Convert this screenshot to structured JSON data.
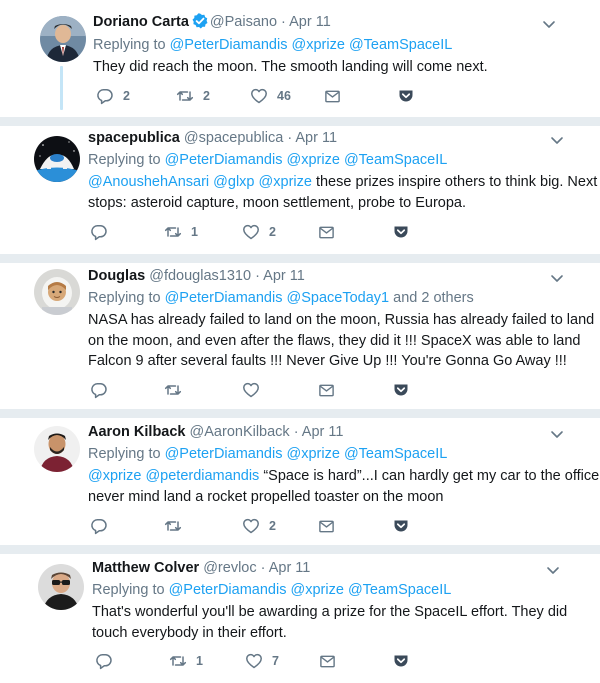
{
  "accent": "#1da1f2",
  "tweets": [
    {
      "name": "Doriano Carta",
      "verified": true,
      "handle": "@Paisano",
      "separator": "·",
      "date": "Apr 11",
      "replying_label": "Replying to",
      "replying_to": [
        "@PeterDiamandis",
        "@xprize",
        "@TeamSpaceIL"
      ],
      "body_text": "They did reach the moon. The smooth landing will come next.",
      "replies": "2",
      "retweets": "2",
      "likes": "46"
    },
    {
      "name": "spacepublica",
      "handle": "@spacepublica",
      "separator": "·",
      "date": "Apr 11",
      "replying_label": "Replying to",
      "replying_to": [
        "@PeterDiamandis",
        "@xprize",
        "@TeamSpaceIL"
      ],
      "body_mentions": [
        "@AnoushehAnsari",
        "@glxp",
        "@xprize"
      ],
      "body_text_a": "these prizes inspire others to think big. Next",
      "body_text_b": "stops: asteroid capture, moon settlement, probe to Europa.",
      "replies": "",
      "retweets": "1",
      "likes": "2"
    },
    {
      "name": "Douglas",
      "handle": "@fdouglas1310",
      "separator": "·",
      "date": "Apr 11",
      "replying_label": "Replying to",
      "replying_to": [
        "@PeterDiamandis",
        "@SpaceToday1"
      ],
      "replying_extra": "and 2 others",
      "body_lines": [
        "NASA has already failed to land on the moon, Russia has already failed to land",
        "on the moon, and even after the flaws, they did it !!! SpaceX was able to land",
        "Falcon 9 after several faults !!! Never Give Up !!! You're Gonna Go Away !!!"
      ],
      "replies": "",
      "retweets": "",
      "likes": ""
    },
    {
      "name": "Aaron Kilback",
      "handle": "@AaronKilback",
      "separator": "·",
      "date": "Apr 11",
      "replying_label": "Replying to",
      "replying_to": [
        "@PeterDiamandis",
        "@xprize",
        "@TeamSpaceIL"
      ],
      "body_mentions": [
        "@xprize",
        "@peterdiamandis"
      ],
      "body_text_a": "“Space is hard”...I can hardly get my car to the office",
      "body_text_b": "never mind land a rocket propelled toaster on the moon",
      "replies": "",
      "retweets": "",
      "likes": "2"
    },
    {
      "name": "Matthew Colver",
      "handle": "@revloc",
      "separator": "·",
      "date": "Apr 11",
      "replying_label": "Replying to",
      "replying_to": [
        "@PeterDiamandis",
        "@xprize",
        "@TeamSpaceIL"
      ],
      "body_lines": [
        "That's wonderful you'll be awarding a prize for the SpaceIL effort. They did",
        "touch everybody in their effort."
      ],
      "replies": "",
      "retweets": "1",
      "likes": "7"
    }
  ]
}
